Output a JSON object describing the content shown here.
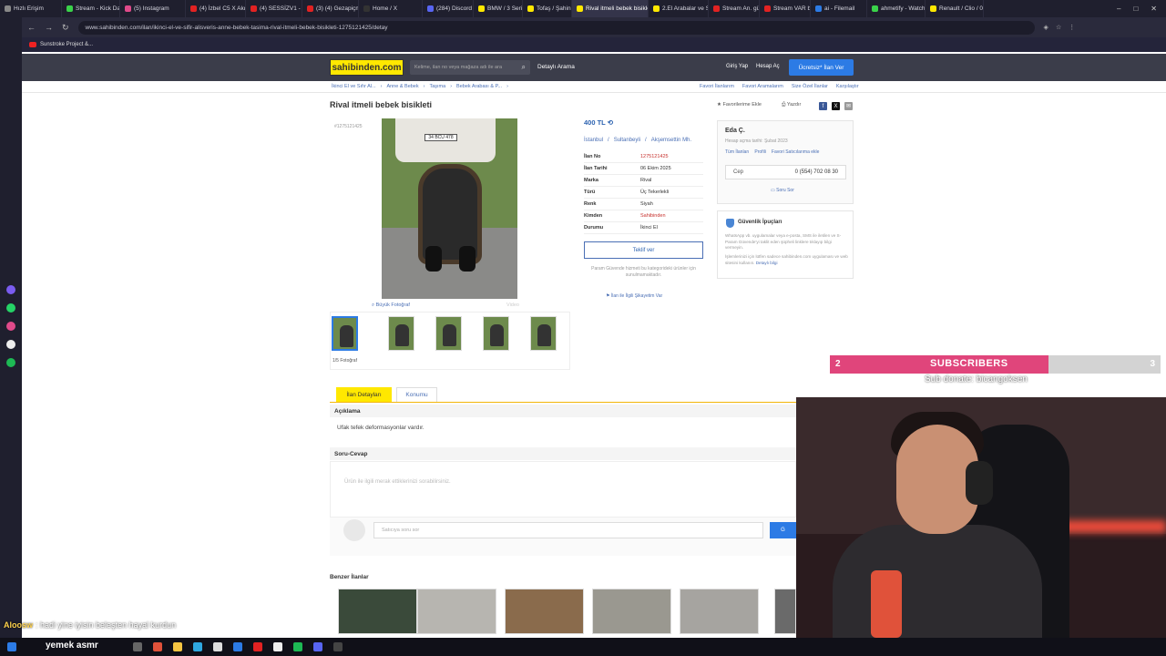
{
  "browser": {
    "tabs": [
      {
        "label": "Hızlı Erişim",
        "color": "#888888",
        "w": 68
      },
      {
        "label": "Stream - Kick Dash",
        "color": "#3ad24a",
        "w": 64
      },
      {
        "label": "(5) Instagram",
        "color": "#e04a8a",
        "w": 72
      },
      {
        "label": "(4) İzbel C5 X Akdı",
        "color": "#e22222",
        "w": 66
      },
      {
        "label": "(4) SESSİZV1 - LVB",
        "color": "#e22222",
        "w": 62
      },
      {
        "label": "(3) (4) Gezapiçm",
        "color": "#e22222",
        "w": 62
      },
      {
        "label": "Home / X",
        "color": "#333333",
        "w": 70
      },
      {
        "label": "(284) Discord | #",
        "color": "#5865f2",
        "w": 56
      },
      {
        "label": "BMW / 3 Serisi / 3",
        "color": "#ffe800",
        "w": 54
      },
      {
        "label": "Tofaş / Şahin / 1.6",
        "color": "#ffe800",
        "w": 54
      },
      {
        "label": "Rival itmeli bebek bisikleti",
        "color": "#ffe800",
        "w": 84,
        "active": true
      },
      {
        "label": "2.El Arabalar ve Sat",
        "color": "#ffe800",
        "w": 66
      },
      {
        "label": "Stream An. güncl",
        "color": "#e22222",
        "w": 56
      },
      {
        "label": "Stream VAR by ne",
        "color": "#e22222",
        "w": 56
      },
      {
        "label": "ai - Filemail",
        "color": "#2c7be5",
        "w": 62
      },
      {
        "label": "ahmetify - Watch",
        "color": "#3ad24a",
        "w": 64
      },
      {
        "label": "Renault / Clio / 0.9",
        "color": "#ffe800",
        "w": 64
      }
    ],
    "url": "www.sahibinden.com/ilan/ikinci-el-ve-sifir-alisveris-anne-bebek-tasima-rival-itmeli-bebek-bisikleti-1275121425/detay",
    "bookmark": "Sunstroke Project &..."
  },
  "header": {
    "logo": "sahibinden.com",
    "search_placeholder": "Kelime, ilan no veya mağaza adı ile ara",
    "detailed_search": "Detaylı Arama",
    "login": "Giriş Yap",
    "register": "Hesap Aç",
    "post_ad": "Ücretsiz* İlan Ver"
  },
  "breadcrumbs": [
    "İkinci El ve Sıfır Al...",
    "Anne & Bebek",
    "Taşıma",
    "Bebek Arabası & P..."
  ],
  "top_links": [
    "Favori İlanlarım",
    "Favori Aramalarım",
    "Size Özel İlanlar",
    "Karşılaştır"
  ],
  "listing": {
    "title": "Rival itmeli bebek bisikleti",
    "add_favorite": "Favorilerime Ekle",
    "print": "Yazdır",
    "ad_number_small": "#1275121425",
    "plate": "34 BCU 478",
    "big_photo": "Büyük Fotoğraf",
    "video": "Video",
    "photo_count": "1/5 Fotoğraf",
    "price": "400 TL",
    "location": [
      "İstanbul",
      "/",
      "Sultanbeyli",
      "/",
      "Akşemsettin Mh."
    ],
    "info": [
      {
        "k": "İlan No",
        "v": "1275121425",
        "red": true
      },
      {
        "k": "İlan Tarihi",
        "v": "06 Ekim 2025"
      },
      {
        "k": "Marka",
        "v": "Rival"
      },
      {
        "k": "Türü",
        "v": "Üç Tekerlekli"
      },
      {
        "k": "Renk",
        "v": "Siyah"
      },
      {
        "k": "Kimden",
        "v": "Sahibinden",
        "red": true
      },
      {
        "k": "Durumu",
        "v": "İkinci El"
      }
    ],
    "offer_button": "Teklif ver",
    "param_note": "Param Güvende hizmeti bu kategorideki ürünler için sunulmamaktadır.",
    "report": "İlan ile İlgili Şikayetim Var"
  },
  "seller": {
    "name": "Eda Ç.",
    "since": "Hesap açma tarihi: Şubat 2023",
    "links": [
      "Tüm İlanları",
      "Profili",
      "Favori Satıcılarıma ekle"
    ],
    "phone_label": "Cep",
    "phone": "0 (554) 702 08 30",
    "ask": "Soru Sor"
  },
  "tips": {
    "title": "Güvenlik İpuçları",
    "text1": "WhatsApp vb. uygulamalar veya e-posta, SMS ile iletilen ve S-Param Güvende'yi taklit eden şüpheli linklere tıklayıp bilgi vermeyin.",
    "text2": "İşlemlerinizi için lütfen sadece sahibinden.com uygulaması ve web sitesini kullanın.",
    "more": "Detaylı bilgi"
  },
  "tabs": {
    "detail": "İlan Detayları",
    "location": "Konumu"
  },
  "description": {
    "head": "Açıklama",
    "text": "Ufak tefek deformasyonlar vardır."
  },
  "qa": {
    "head": "Soru-Cevap",
    "empty": "Ürün ile ilgili merak ettiklerinizi sorabilirsiniz.",
    "input_placeholder": "Satıcıya soru sor",
    "send": "G"
  },
  "similar": {
    "title": "Benzer İlanlar"
  },
  "overlay": {
    "subs_count": "2",
    "subs_label": "SUBSCRIBERS",
    "subs_goal": "3",
    "subs_progress": 0.66,
    "donate": "Sub donate: bicangoksen",
    "chat_user": "Aloosw",
    "chat_text": ": hadi yine iyisin beleşten hayal kurdun",
    "caption": "yemek asmr"
  }
}
